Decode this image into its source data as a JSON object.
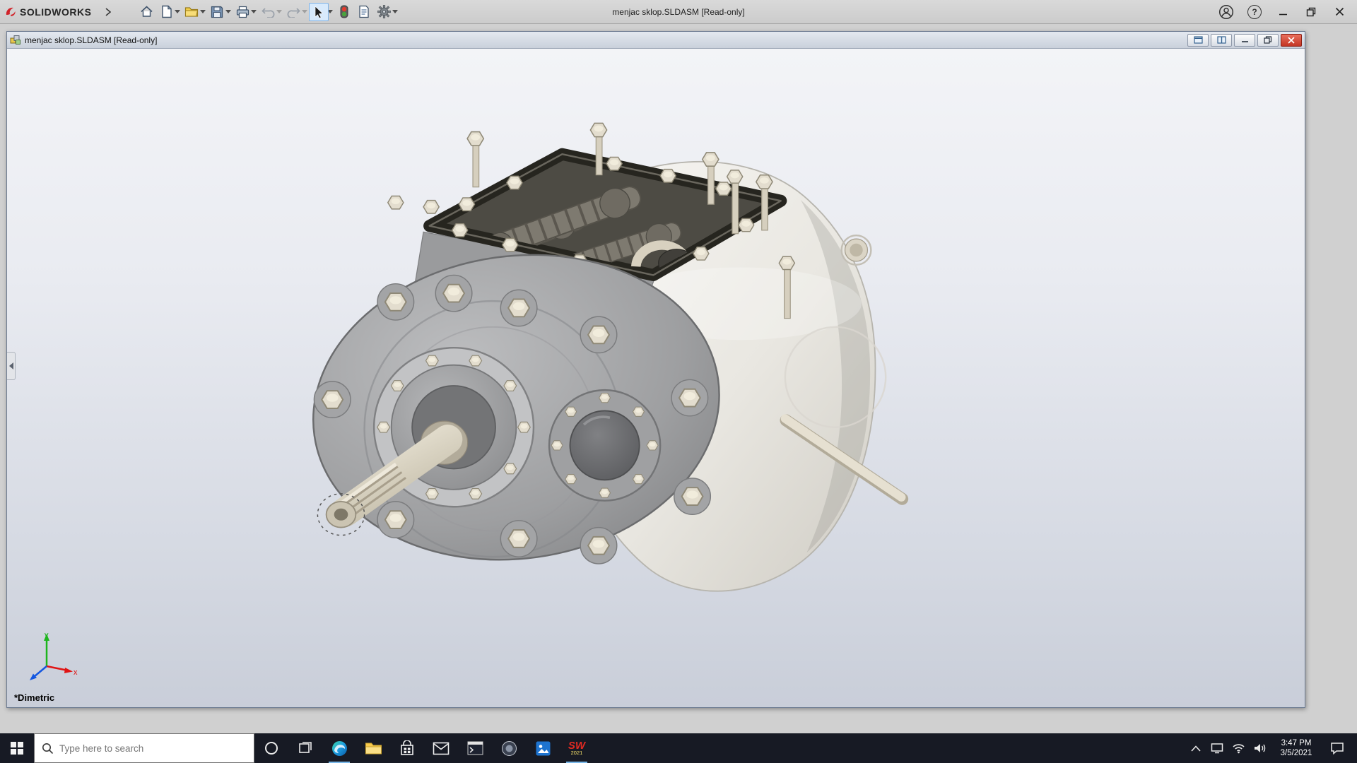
{
  "app": {
    "brand": "SOLIDWORKS",
    "title": "menjac sklop.SLDASM [Read-only]"
  },
  "doc": {
    "title": "menjac sklop.SLDASM [Read-only]"
  },
  "viewport": {
    "view_label": "*Dimetric",
    "triad": {
      "x": "x",
      "y": "y"
    }
  },
  "glyphs": {
    "help": "?"
  },
  "taskbar": {
    "search_placeholder": "Type here to search",
    "sw_glyph": "SW",
    "sw_badge": "2021",
    "clock_time": "3:47 PM",
    "clock_date": "3/5/2021"
  },
  "colors": {
    "brand_red": "#d1232a",
    "close_red": "#c33524",
    "taskbar_bg": "#171a24",
    "select_highlight": "#d8eafc",
    "viewport_top": "#f3f4f7",
    "viewport_bottom": "#c9ced9"
  }
}
